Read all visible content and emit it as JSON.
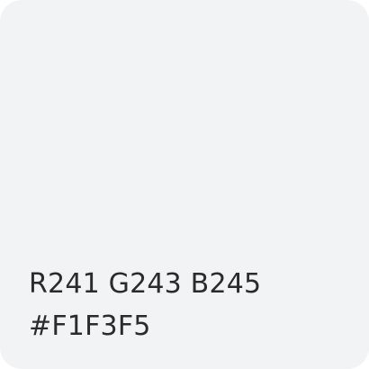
{
  "swatch": {
    "background_color": "#F1F3F5",
    "text_color": "#2A2B2E",
    "rgb_label": "R241 G243 B245",
    "hex_label": "#F1F3F5"
  }
}
